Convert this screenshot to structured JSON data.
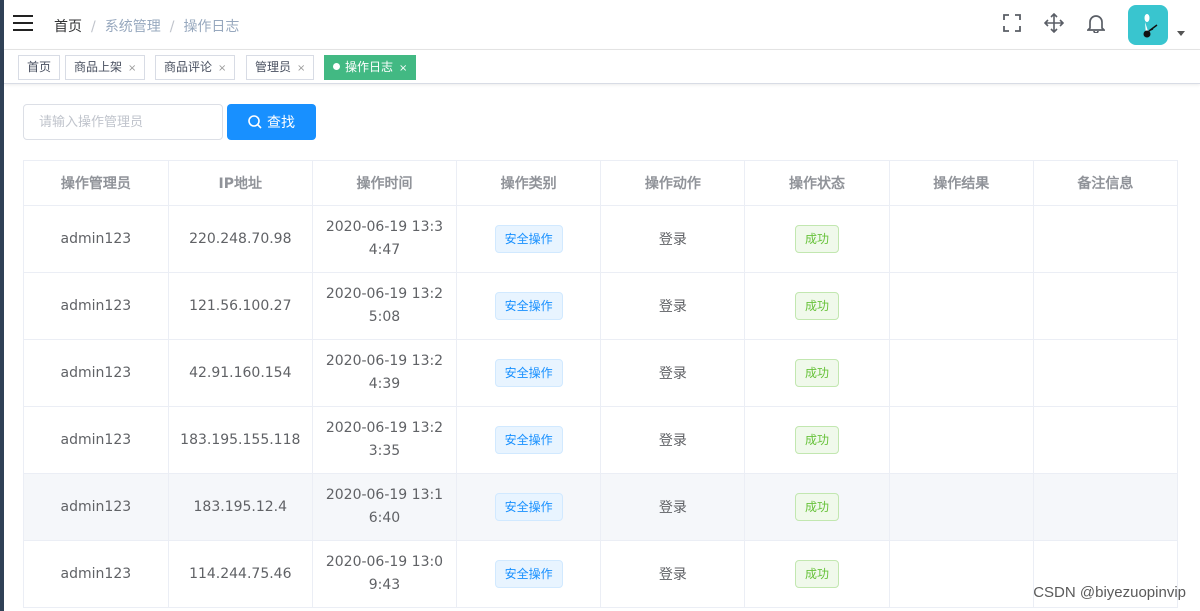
{
  "navbar": {
    "breadcrumb": [
      "首页",
      "系统管理",
      "操作日志"
    ],
    "separator": "/",
    "icons": [
      "fullscreen-icon",
      "size-icon",
      "bell-icon"
    ]
  },
  "tags": [
    {
      "label": "首页",
      "active": false,
      "closable": false
    },
    {
      "label": "商品上架",
      "active": false,
      "closable": true
    },
    {
      "label": "商品评论",
      "active": false,
      "closable": true
    },
    {
      "label": "管理员",
      "active": false,
      "closable": true
    },
    {
      "label": "操作日志",
      "active": true,
      "closable": true
    }
  ],
  "close_glyph": "×",
  "search": {
    "placeholder": "请输入操作管理员",
    "button_label": "查找"
  },
  "table": {
    "headers": [
      "操作管理员",
      "IP地址",
      "操作时间",
      "操作类别",
      "操作动作",
      "操作状态",
      "操作结果",
      "备注信息"
    ],
    "rows": [
      {
        "admin": "admin123",
        "ip": "220.248.70.98",
        "time": "2020-06-19 13:34:47",
        "category": "安全操作",
        "action": "登录",
        "status": "成功",
        "result": "",
        "remark": ""
      },
      {
        "admin": "admin123",
        "ip": "121.56.100.27",
        "time": "2020-06-19 13:25:08",
        "category": "安全操作",
        "action": "登录",
        "status": "成功",
        "result": "",
        "remark": ""
      },
      {
        "admin": "admin123",
        "ip": "42.91.160.154",
        "time": "2020-06-19 13:24:39",
        "category": "安全操作",
        "action": "登录",
        "status": "成功",
        "result": "",
        "remark": ""
      },
      {
        "admin": "admin123",
        "ip": "183.195.155.118",
        "time": "2020-06-19 13:23:35",
        "category": "安全操作",
        "action": "登录",
        "status": "成功",
        "result": "",
        "remark": ""
      },
      {
        "admin": "admin123",
        "ip": "183.195.12.4",
        "time": "2020-06-19 13:16:40",
        "category": "安全操作",
        "action": "登录",
        "status": "成功",
        "result": "",
        "remark": ""
      },
      {
        "admin": "admin123",
        "ip": "114.244.75.46",
        "time": "2020-06-19 13:09:43",
        "category": "安全操作",
        "action": "登录",
        "status": "成功",
        "result": "",
        "remark": ""
      }
    ],
    "hover_row": 4
  },
  "colors": {
    "primary": "#1890ff",
    "tag_active": "#42b983",
    "success": "#67c23a",
    "avatar_bg": "#39c5cf"
  },
  "watermark": "CSDN @biyezuopinvip"
}
